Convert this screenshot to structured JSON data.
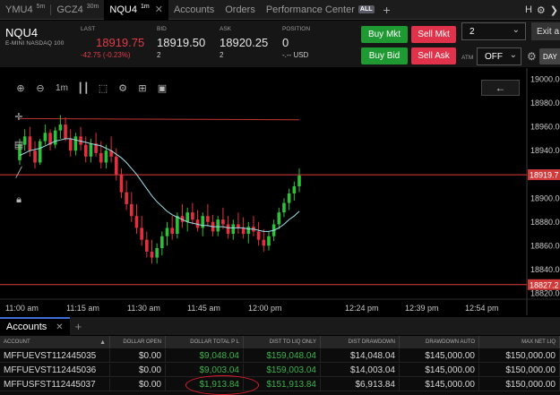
{
  "tabs": [
    {
      "label": "YMU4",
      "interval": "5m",
      "active": false
    },
    {
      "label": "GCZ4",
      "interval": "30m",
      "active": false
    },
    {
      "label": "NQU4",
      "interval": "1m",
      "active": true
    }
  ],
  "nav": {
    "accounts": "Accounts",
    "orders": "Orders",
    "performance": "Performance Center",
    "all_badge": "ALL"
  },
  "quote": {
    "symbol": "NQU4",
    "description": "E-MINI NASDAQ 100",
    "last_label": "LAST",
    "last": "18919.75",
    "change": "-42.75 (-0.23%)",
    "bid_label": "BID",
    "bid": "18919.50",
    "bid_size": "2",
    "ask_label": "ASK",
    "ask": "18920.25",
    "ask_size": "2",
    "position_label": "POSITION",
    "position": "0",
    "position_sub": "-.-- USD"
  },
  "trade": {
    "buy_mkt": "Buy Mkt",
    "sell_mkt": "Sell Mkt",
    "buy_bid": "Buy Bid",
    "sell_ask": "Sell Ask",
    "quantity": "2",
    "exit_label": "Exit a",
    "atm_label": "ATM",
    "atm_value": "OFF",
    "day_label": "DAY"
  },
  "chart_toolbar": {
    "interval": "1m"
  },
  "chart_data": {
    "type": "candlestick",
    "symbol": "NQU4",
    "interval": "1m",
    "xlabels": [
      "11:00 am",
      "11:15 am",
      "11:30 am",
      "11:45 am",
      "12:00 pm",
      "12:24 pm",
      "12:39 pm",
      "12:54 pm"
    ],
    "ylabels": [
      "19000.00",
      "18980.00",
      "18960.00",
      "18940.00",
      "18920.00",
      "18900.00",
      "18880.00",
      "18860.00",
      "18840.00",
      "18820.00"
    ],
    "ylim": [
      18815,
      19005
    ],
    "last_price_tag": "18919.7",
    "low_level_tag": "18827.2",
    "horizontal_lines": [
      {
        "price": 18919.75,
        "color": "#e23a3a"
      },
      {
        "price": 18827.25,
        "color": "#e23a3a"
      }
    ],
    "sloped_line": {
      "from": 18967,
      "to": 18966,
      "color": "#c0352f"
    },
    "candles": [
      [
        18932,
        18950,
        18928,
        18945
      ],
      [
        18945,
        18958,
        18940,
        18952
      ],
      [
        18952,
        18960,
        18935,
        18940
      ],
      [
        18940,
        18948,
        18925,
        18930
      ],
      [
        18930,
        18950,
        18928,
        18948
      ],
      [
        18948,
        18962,
        18945,
        18955
      ],
      [
        18955,
        18958,
        18940,
        18945
      ],
      [
        18945,
        18960,
        18942,
        18957
      ],
      [
        18957,
        18970,
        18950,
        18962
      ],
      [
        18962,
        18968,
        18948,
        18950
      ],
      [
        18950,
        18958,
        18935,
        18940
      ],
      [
        18940,
        18955,
        18936,
        18952
      ],
      [
        18952,
        18960,
        18940,
        18945
      ],
      [
        18945,
        18952,
        18930,
        18935
      ],
      [
        18935,
        18950,
        18930,
        18946
      ],
      [
        18946,
        18955,
        18935,
        18938
      ],
      [
        18938,
        18948,
        18925,
        18930
      ],
      [
        18930,
        18945,
        18925,
        18940
      ],
      [
        18940,
        18952,
        18930,
        18935
      ],
      [
        18935,
        18942,
        18915,
        18920
      ],
      [
        18920,
        18925,
        18900,
        18905
      ],
      [
        18905,
        18915,
        18890,
        18895
      ],
      [
        18895,
        18905,
        18880,
        18885
      ],
      [
        18885,
        18895,
        18870,
        18875
      ],
      [
        18875,
        18885,
        18860,
        18865
      ],
      [
        18865,
        18872,
        18850,
        18855
      ],
      [
        18855,
        18865,
        18845,
        18850
      ],
      [
        18850,
        18862,
        18845,
        18858
      ],
      [
        18858,
        18872,
        18852,
        18868
      ],
      [
        18868,
        18880,
        18860,
        18875
      ],
      [
        18875,
        18885,
        18865,
        18870
      ],
      [
        18870,
        18888,
        18866,
        18885
      ],
      [
        18885,
        18895,
        18875,
        18880
      ],
      [
        18880,
        18892,
        18872,
        18888
      ],
      [
        18888,
        18896,
        18878,
        18882
      ],
      [
        18882,
        18890,
        18872,
        18875
      ],
      [
        18875,
        18888,
        18868,
        18885
      ],
      [
        18885,
        18895,
        18876,
        18880
      ],
      [
        18880,
        18886,
        18868,
        18872
      ],
      [
        18872,
        18885,
        18868,
        18882
      ],
      [
        18882,
        18892,
        18874,
        18878
      ],
      [
        18878,
        18885,
        18866,
        18870
      ],
      [
        18870,
        18882,
        18865,
        18878
      ],
      [
        18878,
        18888,
        18870,
        18875
      ],
      [
        18875,
        18884,
        18866,
        18870
      ],
      [
        18870,
        18880,
        18862,
        18876
      ],
      [
        18876,
        18885,
        18868,
        18872
      ],
      [
        18872,
        18880,
        18860,
        18865
      ],
      [
        18865,
        18874,
        18855,
        18860
      ],
      [
        18860,
        18872,
        18856,
        18868
      ],
      [
        18868,
        18882,
        18864,
        18878
      ],
      [
        18878,
        18892,
        18874,
        18888
      ],
      [
        18888,
        18900,
        18884,
        18896
      ],
      [
        18896,
        18908,
        18890,
        18904
      ],
      [
        18904,
        18914,
        18898,
        18910
      ],
      [
        18910,
        18925,
        18905,
        18919
      ]
    ],
    "moving_average": [
      18936,
      18938,
      18940,
      18941,
      18942,
      18944,
      18946,
      18948,
      18949,
      18950,
      18950,
      18949,
      18948,
      18947,
      18946,
      18945,
      18944,
      18942,
      18940,
      18937,
      18934,
      18930,
      18925,
      18920,
      18914,
      18908,
      18902,
      18897,
      18893,
      18889,
      18886,
      18884,
      18882,
      18880,
      18879,
      18878,
      18877,
      18877,
      18876,
      18876,
      18876,
      18875,
      18875,
      18875,
      18875,
      18874,
      18874,
      18873,
      18872,
      18872,
      18873,
      18875,
      18878,
      18882,
      18885,
      18889
    ]
  },
  "accounts_panel": {
    "tab_label": "Accounts",
    "columns": [
      "ACCOUNT",
      "DOLLAR OPEN",
      "DOLLAR TOTAL P L",
      "DIST TO LIQ ONLY",
      "DIST DRAWDOWN",
      "DRAWDOWN AUTO",
      "MAX NET LIQ"
    ],
    "rows": [
      [
        "MFFUEVST112445035",
        "$0.00",
        "$9,048.04",
        "$159,048.04",
        "$14,048.04",
        "$145,000.00",
        "$150,000.00"
      ],
      [
        "MFFUEVST112445036",
        "$0.00",
        "$9,003.04",
        "$159,003.04",
        "$14,003.04",
        "$145,000.00",
        "$150,000.00"
      ],
      [
        "MFFUSFST112445037",
        "$0.00",
        "$1,913.84",
        "$151,913.84",
        "$6,913.84",
        "$145,000.00",
        "$150,000.00"
      ]
    ],
    "colors": {
      "positive": "#3bb34a",
      "highlight_circle": "#e01e2e"
    }
  }
}
